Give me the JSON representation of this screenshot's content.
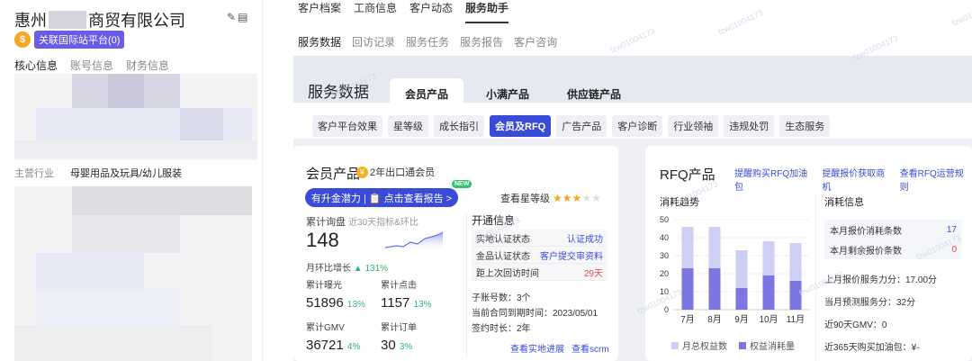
{
  "left": {
    "company_prefix": "惠州",
    "company_suffix": "商贸有限公司",
    "medal": "$",
    "badge": "关联国际站平台(0)",
    "tabs": [
      "核心信息",
      "账号信息",
      "财务信息"
    ],
    "industry_label": "主营行业",
    "industry_value": "母婴用品及玩具/幼儿服装"
  },
  "top_tabs": [
    "客户档案",
    "工商信息",
    "客户动态",
    "服务助手"
  ],
  "sub_tabs": [
    "服务数据",
    "回访记录",
    "服务任务",
    "服务报告",
    "客户咨询"
  ],
  "panel": {
    "title": "服务数据",
    "product_tabs": [
      "会员产品",
      "小满产品",
      "供应链产品"
    ],
    "chips": [
      "客户平台效果",
      "星等级",
      "成长指引",
      "会员及RFQ",
      "广告产品",
      "客户诊断",
      "行业领袖",
      "违规处罚",
      "生态服务"
    ]
  },
  "member": {
    "title": "会员产品",
    "gold_icon": "¥",
    "gold_label": "2年出口通会员",
    "banner": "有升金潜力 | 📋 点击查看报告 >",
    "new_tag": "NEW",
    "star_label": "查看星等级",
    "stars": 3,
    "stars_total": 5,
    "inquiry_label": "累计询盘",
    "inquiry_sub": "近30天指标&环比",
    "inquiry_value": "148",
    "mom_label": "月环比增长",
    "mom_value": "▲ 131%",
    "exposure_label": "累计曝光",
    "exposure_value": "51896",
    "exposure_pct": "13%",
    "clicks_label": "累计点击",
    "clicks_value": "1157",
    "clicks_pct": "13%",
    "gmv_label": "累计GMV",
    "gmv_value": "36721",
    "gmv_pct": "4%",
    "orders_label": "累计订单",
    "orders_value": "30",
    "orders_pct": "3%",
    "open_title": "开通信息",
    "open_rows": [
      {
        "k": "实地认证状态",
        "v": "认证成功"
      },
      {
        "k": "金品认证状态",
        "v": "客户提交审资料"
      },
      {
        "k": "距上次回访时间",
        "v": "29天"
      }
    ],
    "subaccounts": "子账号数：3个",
    "contract_end": "当前合同到期时间：2023/05/01",
    "contract_len": "签约时长：2年",
    "link1": "查看实地进展",
    "link2": "查看scrm"
  },
  "rfq": {
    "title": "RFQ产品",
    "links": [
      "提醒购买RFQ加油包",
      "提醒报价获取商机",
      "查看RFQ运营规则"
    ],
    "trend_title": "消耗趋势",
    "info_title": "消耗信息",
    "rows": [
      {
        "k": "本月报价消耗条数",
        "v": "17"
      },
      {
        "k": "本月剩余报价条数",
        "v": "0"
      }
    ],
    "lines": [
      "上月报价服务力分：17.00分",
      "当月预测服务分：32分",
      "近90天GMV：0",
      "近365天购买加油包：¥-"
    ],
    "legend": [
      "月总权益数",
      "权益消耗量"
    ],
    "colors": {
      "total": "#cdd0f3",
      "used": "#7b76e0",
      "accent": "#3a4bd8"
    }
  },
  "chart_data": {
    "type": "bar",
    "categories": [
      "7月",
      "8月",
      "9月",
      "10月",
      "11月"
    ],
    "series": [
      {
        "name": "月总权益数",
        "values": [
          46,
          46,
          33,
          38,
          37
        ]
      },
      {
        "name": "权益消耗量",
        "values": [
          23,
          23,
          12,
          19,
          16
        ]
      }
    ],
    "ylim": [
      0,
      50
    ],
    "yticks": [
      "0",
      "10",
      "20",
      "30",
      "40",
      "50"
    ]
  },
  "watermark": "fzw01004173"
}
